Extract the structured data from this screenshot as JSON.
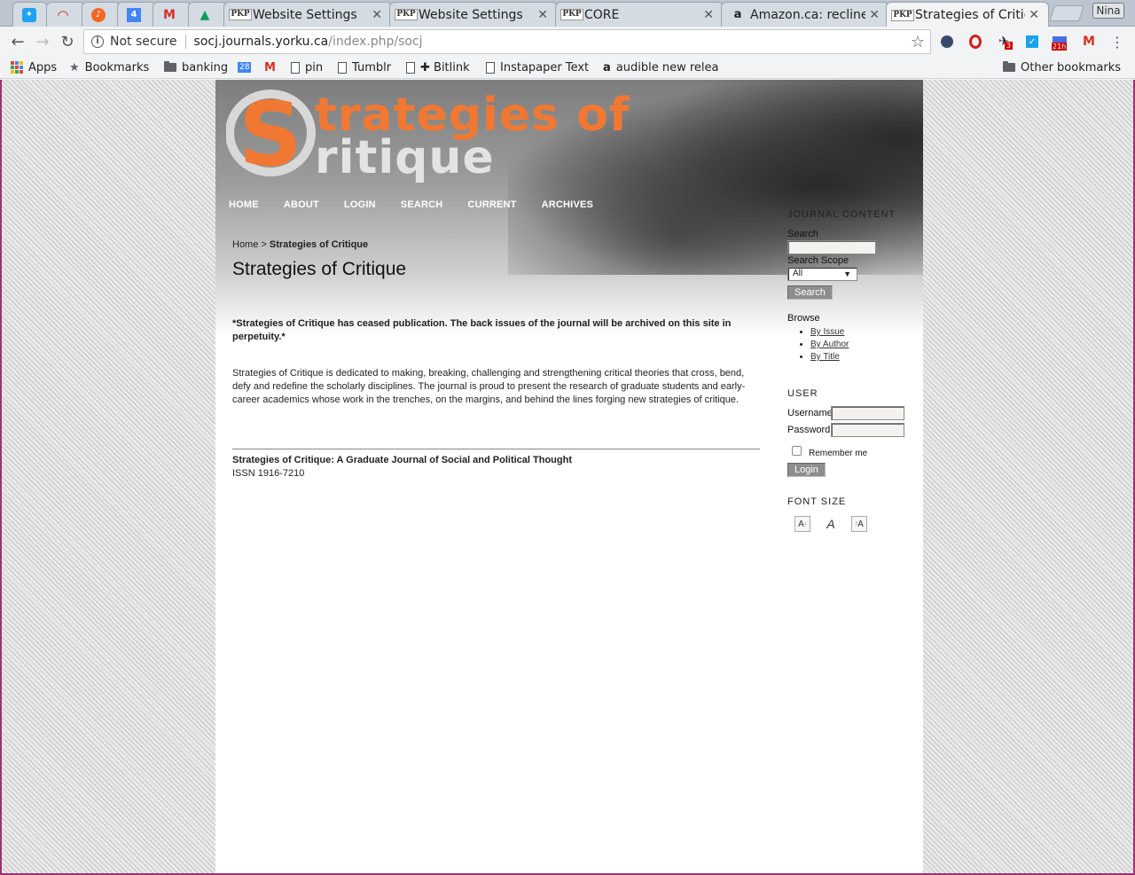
{
  "browser": {
    "tabs": [
      {
        "icon": "twitter-icon",
        "title": ""
      },
      {
        "icon": "red-arc-icon",
        "title": ""
      },
      {
        "icon": "orange-circle-icon",
        "title": ""
      },
      {
        "icon": "calendar-4-icon",
        "title": "4"
      },
      {
        "icon": "gmail-icon",
        "title": ""
      },
      {
        "icon": "google-drive-icon",
        "title": ""
      },
      {
        "icon": "pkp-icon",
        "title": "Website Settings"
      },
      {
        "icon": "pkp-icon",
        "title": "Website Settings"
      },
      {
        "icon": "pkp-icon",
        "title": "CORE"
      },
      {
        "icon": "amazon-icon",
        "title": "Amazon.ca: recline"
      },
      {
        "icon": "pkp-icon",
        "title": "Strategies of Critiq"
      }
    ],
    "profile_name": "Nina",
    "pkp_badge": "PKP",
    "security_label": "Not secure",
    "url_host": "socj.journals.yorku.ca",
    "url_path": "/index.php/socj",
    "extension_badges": {
      "badge_count": "3",
      "badge_time": "21h"
    },
    "bookmarks": [
      {
        "icon": "apps-icon",
        "label": "Apps"
      },
      {
        "icon": "star-icon",
        "label": "Bookmarks"
      },
      {
        "icon": "folder-icon",
        "label": "banking"
      },
      {
        "icon": "calendar-28-icon",
        "label": "28"
      },
      {
        "icon": "gmail-icon",
        "label": ""
      },
      {
        "icon": "page-icon",
        "label": "pin"
      },
      {
        "icon": "page-icon",
        "label": "Tumblr"
      },
      {
        "icon": "page-icon",
        "label": "✚ Bitlink"
      },
      {
        "icon": "page-icon",
        "label": "Instapaper Text"
      },
      {
        "icon": "amazon-icon",
        "label": "audible new relea"
      }
    ],
    "other_bookmarks": "Other bookmarks"
  },
  "site": {
    "logo_line1": "trategies of",
    "logo_line2": "ritique",
    "logo_initial": "S",
    "nav": [
      "HOME",
      "ABOUT",
      "LOGIN",
      "SEARCH",
      "CURRENT",
      "ARCHIVES"
    ],
    "breadcrumb_home": "Home",
    "breadcrumb_sep": ">",
    "breadcrumb_current": "Strategies of Critique",
    "page_title": "Strategies of Critique",
    "notice": "*Strategies of Critique has ceased publication. The back issues of the journal will be archived on this site in perpetuity.*",
    "description": "Strategies of Critique is dedicated to making, breaking, challenging and strengthening critical theories that cross, bend, defy and redefine the scholarly disciplines. The journal is proud to present the research of graduate students and early-career academics whose work in the trenches, on the margins, and behind the lines forging new strategies of critique.",
    "footer_title": "Strategies of Critique: A Graduate Journal of Social and Political Thought",
    "footer_issn": "ISSN 1916-7210"
  },
  "sidebar": {
    "journal_content_title": "JOURNAL CONTENT",
    "search_label": "Search",
    "search_value": "",
    "scope_label": "Search Scope",
    "scope_value": "All",
    "search_button": "Search",
    "browse_label": "Browse",
    "browse_links": [
      "By Issue",
      "By Author",
      "By Title"
    ],
    "user_title": "USER",
    "username_label": "Username",
    "password_label": "Password",
    "remember_label": "Remember me",
    "login_button": "Login",
    "font_size_title": "FONT SIZE",
    "font_icons": [
      "font-smaller-icon",
      "font-default-icon",
      "font-larger-icon"
    ]
  },
  "colors": {
    "logo_orange": "#f07833",
    "page_border": "#a03070"
  }
}
